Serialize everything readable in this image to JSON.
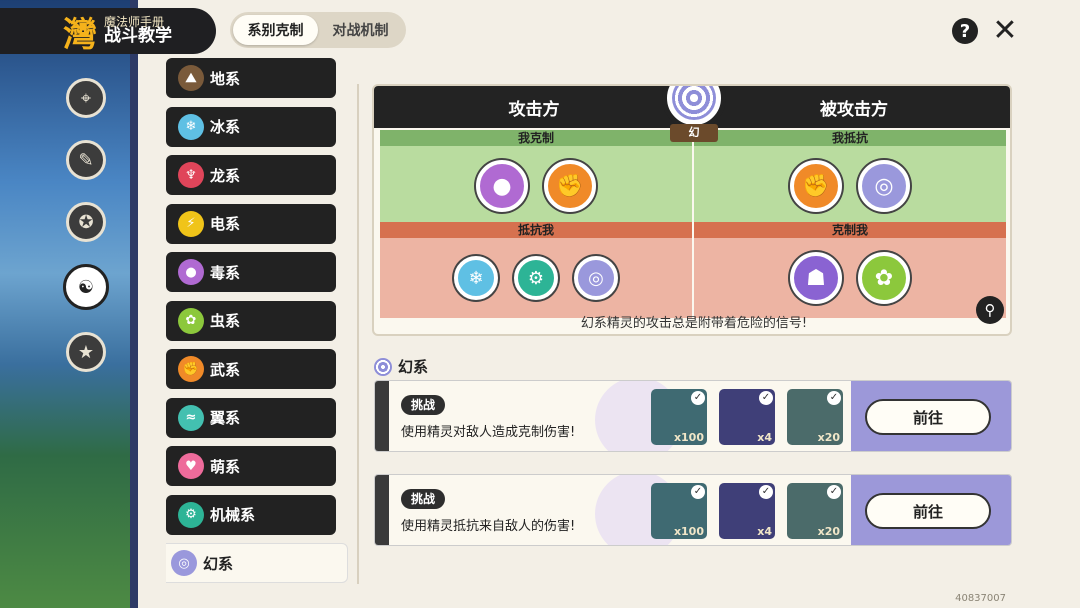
{
  "header": {
    "logo_char": "灣",
    "title_small": "魔法师手册",
    "title_main": "战斗教学"
  },
  "tabs": [
    {
      "label": "系别克制",
      "active": true
    },
    {
      "label": "对战机制",
      "active": false
    }
  ],
  "top_icons": {
    "help": "?",
    "close": "✕"
  },
  "side_nav": [
    "map-icon",
    "book-icon",
    "badge-icon",
    "elements-icon",
    "star-icon"
  ],
  "types": [
    {
      "label": "地系",
      "icon": "earth-icon",
      "color": "#7a5a3a",
      "glyph": "⛰"
    },
    {
      "label": "冰系",
      "icon": "ice-icon",
      "color": "#5fc0e4",
      "glyph": "❄"
    },
    {
      "label": "龙系",
      "icon": "dragon-icon",
      "color": "#e0455a",
      "glyph": "♆"
    },
    {
      "label": "电系",
      "icon": "electric-icon",
      "color": "#f0c419",
      "glyph": "⚡"
    },
    {
      "label": "毒系",
      "icon": "poison-icon",
      "color": "#b06ad2",
      "glyph": "●"
    },
    {
      "label": "虫系",
      "icon": "bug-icon",
      "color": "#8cc83c",
      "glyph": "✿"
    },
    {
      "label": "武系",
      "icon": "fight-icon",
      "color": "#f08a28",
      "glyph": "✊"
    },
    {
      "label": "翼系",
      "icon": "wing-icon",
      "color": "#43c0b0",
      "glyph": "≈"
    },
    {
      "label": "萌系",
      "icon": "cute-icon",
      "color": "#ee6b9b",
      "glyph": "♥"
    },
    {
      "label": "机械系",
      "icon": "mech-icon",
      "color": "#2db496",
      "glyph": "⚙"
    },
    {
      "label": "幻系",
      "icon": "illusion-icon",
      "color": "#9a98dc",
      "glyph": "◎"
    }
  ],
  "chart": {
    "attacker": "攻击方",
    "defender": "被攻击方",
    "center_label": "幻",
    "q_i_counter": "我克制",
    "q_i_resist": "我抵抗",
    "q_resist_me": "抵抗我",
    "q_counter_me": "克制我",
    "i_counter": [
      {
        "icon": "poison-icon",
        "color": "#b06ad2",
        "glyph": "●"
      },
      {
        "icon": "fight-icon",
        "color": "#f08a28",
        "glyph": "✊"
      }
    ],
    "i_resist": [
      {
        "icon": "fight-icon",
        "color": "#f08a28",
        "glyph": "✊"
      },
      {
        "icon": "illusion-icon",
        "color": "#9a98dc",
        "glyph": "◎"
      }
    ],
    "resist_me": [
      {
        "icon": "ice-icon",
        "color": "#5fc0e4",
        "glyph": "❄"
      },
      {
        "icon": "mech-icon",
        "color": "#2db496",
        "glyph": "⚙"
      },
      {
        "icon": "illusion-icon",
        "color": "#9a98dc",
        "glyph": "◎"
      }
    ],
    "counter_me": [
      {
        "icon": "ghost-icon",
        "color": "#8a63d2",
        "glyph": "☗"
      },
      {
        "icon": "bug-icon",
        "color": "#8cc83c",
        "glyph": "✿"
      }
    ],
    "caption": "幻系精灵的攻击总是附带着危险的信号!"
  },
  "section": {
    "title": "幻系"
  },
  "tasks": [
    {
      "tag": "挑战",
      "desc": "使用精灵对敌人造成克制伤害!",
      "go": "前往",
      "rewards": [
        {
          "count": "x100",
          "color": "#3f6a72"
        },
        {
          "count": "x4",
          "color": "#3f3f78"
        },
        {
          "count": "x20",
          "color": "#4b6b6a"
        }
      ]
    },
    {
      "tag": "挑战",
      "desc": "使用精灵抵抗来自敌人的伤害!",
      "go": "前往",
      "rewards": [
        {
          "count": "x100",
          "color": "#3f6a72"
        },
        {
          "count": "x4",
          "color": "#3f3f78"
        },
        {
          "count": "x20",
          "color": "#4b6b6a"
        }
      ]
    }
  ],
  "uid": "40837007"
}
